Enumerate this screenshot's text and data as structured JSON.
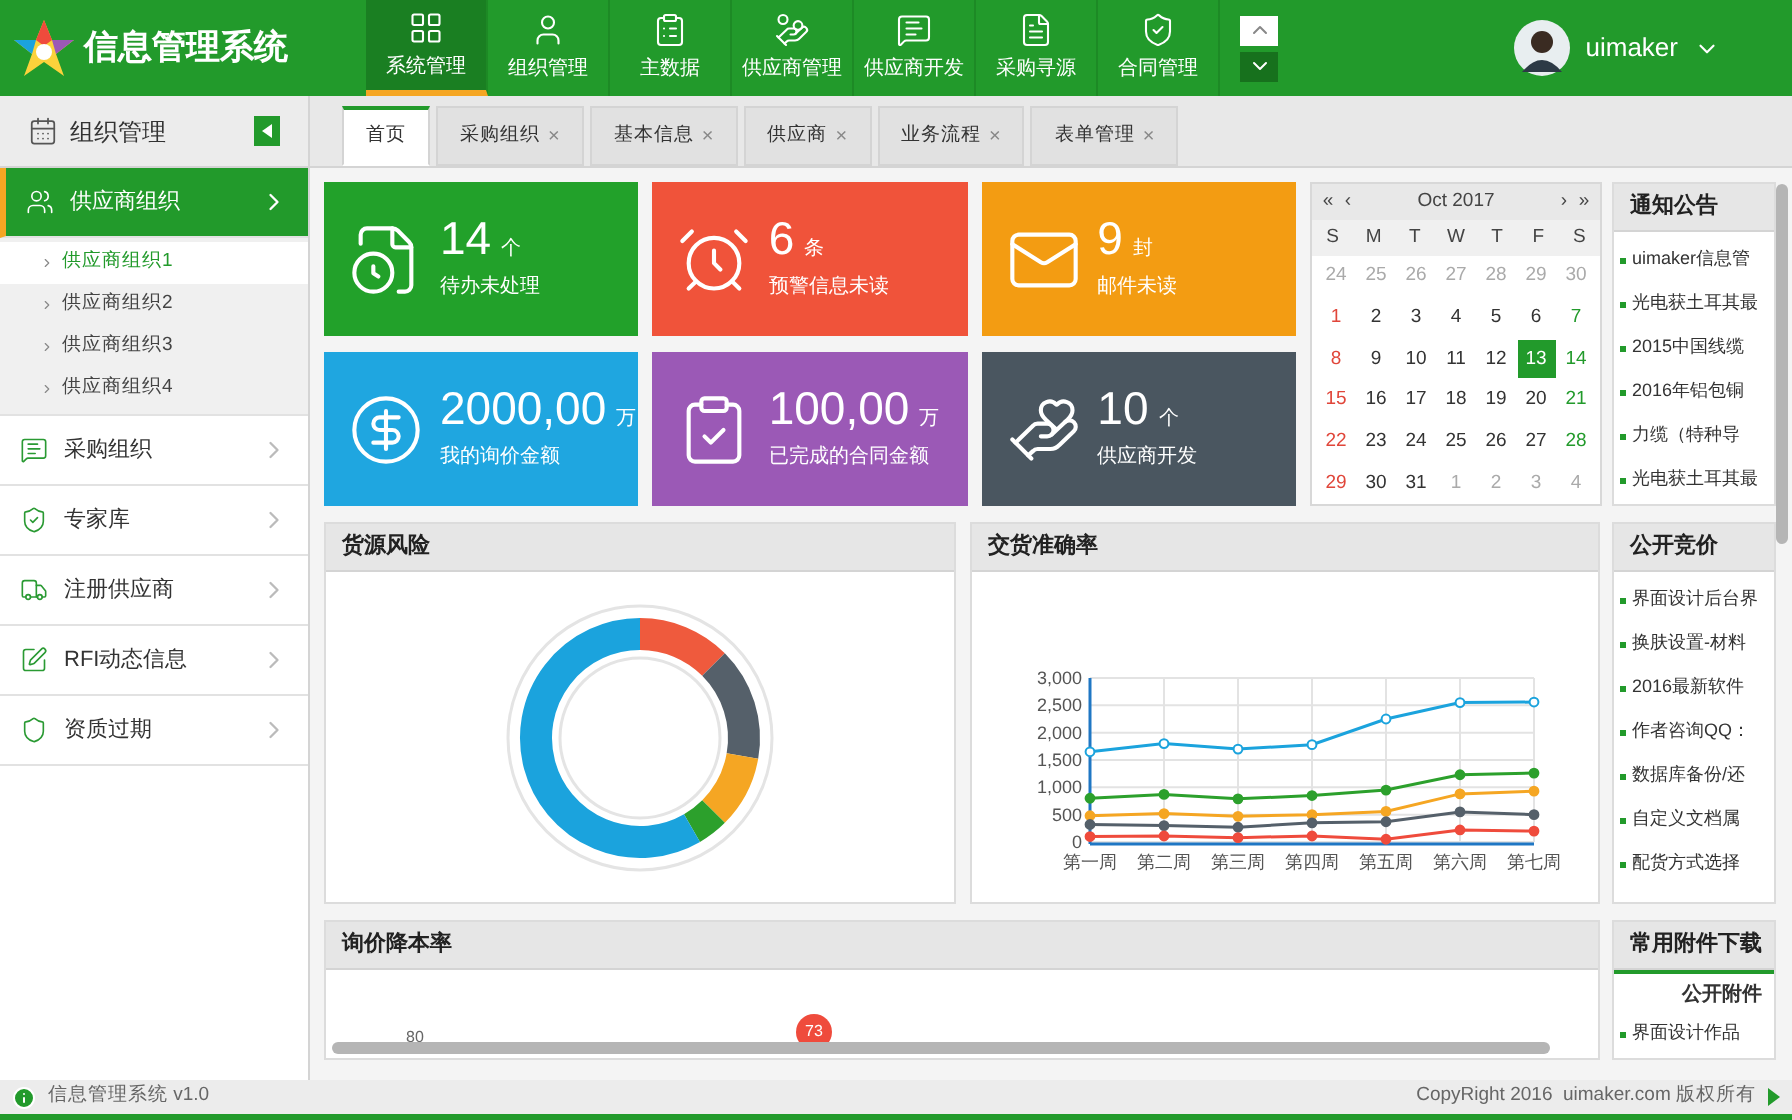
{
  "app": {
    "title": "信息管理系统"
  },
  "nav": [
    {
      "label": "系统管理",
      "selected": true
    },
    {
      "label": "组织管理",
      "selected": false
    },
    {
      "label": "主数据",
      "selected": false
    },
    {
      "label": "供应商管理",
      "selected": false
    },
    {
      "label": "供应商开发",
      "selected": false
    },
    {
      "label": "采购寻源",
      "selected": false
    },
    {
      "label": "合同管理",
      "selected": false
    }
  ],
  "user": {
    "name": "uimaker"
  },
  "sidebar": {
    "title": "组织管理",
    "items": [
      {
        "label": "供应商组织",
        "selected": true,
        "expanded": true,
        "children": [
          {
            "label": "供应商组织1",
            "selected": true
          },
          {
            "label": "供应商组织2",
            "selected": false
          },
          {
            "label": "供应商组织3",
            "selected": false
          },
          {
            "label": "供应商组织4",
            "selected": false
          }
        ]
      },
      {
        "label": "采购组织",
        "selected": false,
        "expanded": false
      },
      {
        "label": "专家库",
        "selected": false,
        "expanded": false
      },
      {
        "label": "注册供应商",
        "selected": false,
        "expanded": false
      },
      {
        "label": "RFI动态信息",
        "selected": false,
        "expanded": false
      },
      {
        "label": "资质过期",
        "selected": false,
        "expanded": false
      }
    ]
  },
  "tabs": [
    {
      "label": "首页",
      "selected": true
    },
    {
      "label": "采购组织",
      "selected": false,
      "close": "×"
    },
    {
      "label": "基本信息",
      "selected": false,
      "close": "×"
    },
    {
      "label": "供应商",
      "selected": false,
      "close": "×"
    },
    {
      "label": "业务流程",
      "selected": false,
      "close": "×"
    },
    {
      "label": "表单管理",
      "selected": false,
      "close": "×"
    }
  ],
  "tiles": [
    {
      "value": "14",
      "unit": "个",
      "label": "待办未处理",
      "color": "#22a12a"
    },
    {
      "value": "6",
      "unit": "条",
      "label": "预警信息未读",
      "color": "#f0533a"
    },
    {
      "value": "9",
      "unit": "封",
      "label": "邮件未读",
      "color": "#f39c12"
    },
    {
      "value": "2000,00",
      "unit": "万",
      "label": "我的询价金额",
      "color": "#1fa6e0"
    },
    {
      "value": "100,00",
      "unit": "万",
      "label": "已完成的合同金额",
      "color": "#9b59b6"
    },
    {
      "value": "10",
      "unit": "个",
      "label": "供应商开发",
      "color": "#4a5660"
    }
  ],
  "calendar": {
    "first": "«",
    "prev": "‹",
    "month": "Oct 2017",
    "next": "›",
    "last": "»",
    "weekdays": [
      "S",
      "M",
      "T",
      "W",
      "T",
      "F",
      "S"
    ],
    "weeks": [
      [
        {
          "d": "24",
          "kind": "other"
        },
        {
          "d": "25",
          "kind": "other"
        },
        {
          "d": "26",
          "kind": "other"
        },
        {
          "d": "27",
          "kind": "other"
        },
        {
          "d": "28",
          "kind": "other"
        },
        {
          "d": "29",
          "kind": "other"
        },
        {
          "d": "30",
          "kind": "other"
        }
      ],
      [
        {
          "d": "1",
          "kind": "day"
        },
        {
          "d": "2",
          "kind": "day"
        },
        {
          "d": "3",
          "kind": "day"
        },
        {
          "d": "4",
          "kind": "day"
        },
        {
          "d": "5",
          "kind": "day"
        },
        {
          "d": "6",
          "kind": "day"
        },
        {
          "d": "7",
          "kind": "day"
        }
      ],
      [
        {
          "d": "8",
          "kind": "day"
        },
        {
          "d": "9",
          "kind": "day"
        },
        {
          "d": "10",
          "kind": "day"
        },
        {
          "d": "11",
          "kind": "day"
        },
        {
          "d": "12",
          "kind": "day"
        },
        {
          "d": "13",
          "kind": "day",
          "selected": true
        },
        {
          "d": "14",
          "kind": "day"
        }
      ],
      [
        {
          "d": "15",
          "kind": "day"
        },
        {
          "d": "16",
          "kind": "day"
        },
        {
          "d": "17",
          "kind": "day"
        },
        {
          "d": "18",
          "kind": "day"
        },
        {
          "d": "19",
          "kind": "day"
        },
        {
          "d": "20",
          "kind": "day"
        },
        {
          "d": "21",
          "kind": "day"
        }
      ],
      [
        {
          "d": "22",
          "kind": "day"
        },
        {
          "d": "23",
          "kind": "day"
        },
        {
          "d": "24",
          "kind": "day"
        },
        {
          "d": "25",
          "kind": "day"
        },
        {
          "d": "26",
          "kind": "day"
        },
        {
          "d": "27",
          "kind": "day"
        },
        {
          "d": "28",
          "kind": "day"
        }
      ],
      [
        {
          "d": "29",
          "kind": "day"
        },
        {
          "d": "30",
          "kind": "day"
        },
        {
          "d": "31",
          "kind": "day"
        },
        {
          "d": "1",
          "kind": "other"
        },
        {
          "d": "2",
          "kind": "other"
        },
        {
          "d": "3",
          "kind": "other"
        },
        {
          "d": "4",
          "kind": "other"
        }
      ]
    ]
  },
  "notices": {
    "title": "通知公告",
    "items": [
      "uimaker信息管",
      "光电获土耳其最",
      "2015中国线缆",
      "2016年铝包铜",
      "力缆（特种导",
      "光电获土耳其最"
    ]
  },
  "risk": {
    "title": "货源风险"
  },
  "accuracy": {
    "title": "交货准确率",
    "chart_data": {
      "type": "line",
      "grid": true,
      "categories": [
        "第一周",
        "第二周",
        "第三周",
        "第四周",
        "第五周",
        "第六周",
        "第七周"
      ],
      "ylim": [
        0,
        3000
      ],
      "yticks": [
        {
          "value": 0,
          "label": "0"
        },
        {
          "value": 500,
          "label": "500"
        },
        {
          "value": 1000,
          "label": "1,000"
        },
        {
          "value": 1500,
          "label": "1,500"
        },
        {
          "value": 2000,
          "label": "2,000"
        },
        {
          "value": 2500,
          "label": "2,500"
        },
        {
          "value": 3000,
          "label": "3,000"
        }
      ],
      "series": [
        {
          "color": "#1ba3dd",
          "marker": "open-circle",
          "values": [
            1650,
            1800,
            1700,
            1780,
            2250,
            2550,
            2560
          ]
        },
        {
          "color": "#2ca02c",
          "marker": "circle",
          "values": [
            800,
            870,
            790,
            850,
            950,
            1230,
            1260
          ]
        },
        {
          "color": "#f5a623",
          "marker": "circle",
          "values": [
            480,
            520,
            470,
            500,
            560,
            880,
            930
          ]
        },
        {
          "color": "#55606a",
          "marker": "circle",
          "values": [
            320,
            300,
            270,
            350,
            370,
            550,
            500
          ]
        },
        {
          "color": "#ef4b3c",
          "marker": "circle",
          "values": [
            100,
            110,
            80,
            110,
            50,
            220,
            200
          ]
        }
      ]
    }
  },
  "bidding": {
    "title": "公开竞价",
    "items": [
      "界面设计后台界",
      "换肤设置-材料",
      "2016最新软件",
      "作者咨询QQ：",
      "数据库备份/还",
      "自定义文档属",
      "配货方式选择"
    ]
  },
  "savings": {
    "title": "询价降本率",
    "axis_label": "80",
    "bubble": "73"
  },
  "downloads": {
    "title": "常用附件下载",
    "subtitle": "公开附件",
    "items": [
      "界面设计作品"
    ]
  },
  "status": {
    "version": "信息管理系统 v1.0",
    "copyright": "CopyRight 2016  uimaker.com 版权所有"
  }
}
